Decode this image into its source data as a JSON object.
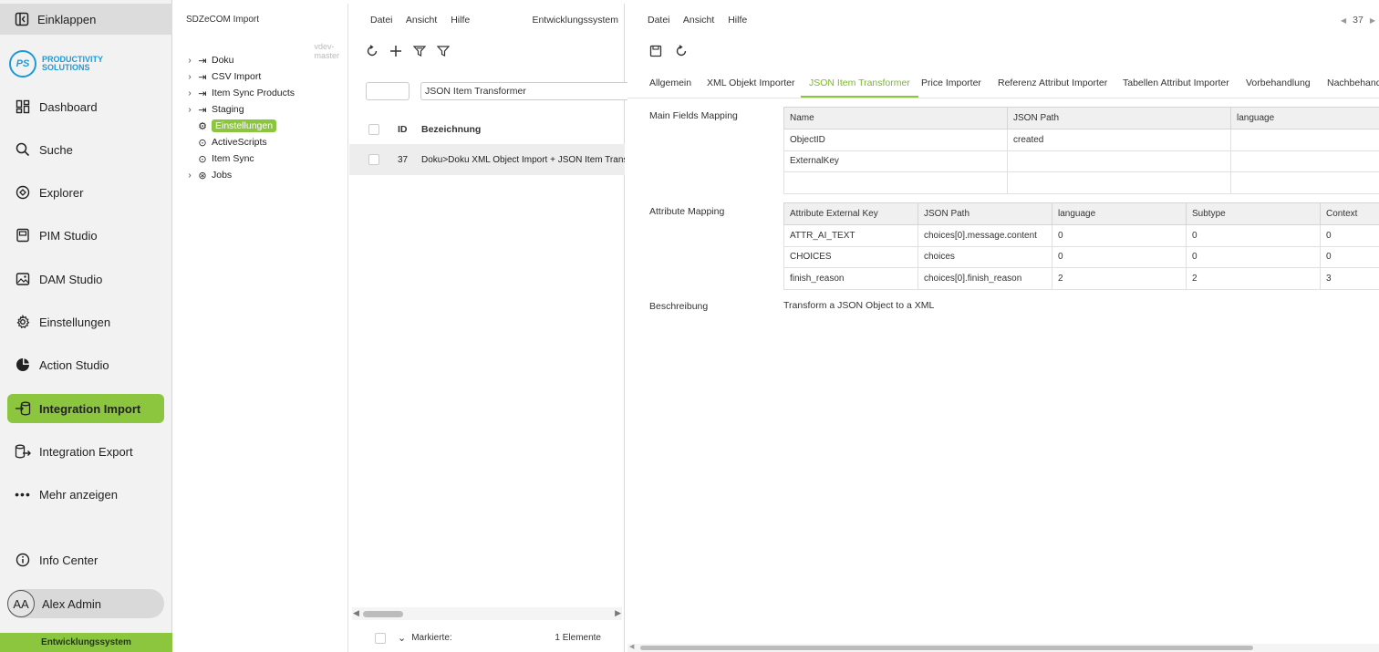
{
  "sidebar": {
    "collapse_label": "Einklappen",
    "logo_mark": "PS",
    "logo_line1": "PRODUCTIVITY",
    "logo_line2": "SOLUTIONS",
    "items": [
      {
        "label": "Dashboard",
        "icon": "dashboard-icon"
      },
      {
        "label": "Suche",
        "icon": "search-icon"
      },
      {
        "label": "Explorer",
        "icon": "explorer-icon"
      },
      {
        "label": "PIM Studio",
        "icon": "pim-icon"
      },
      {
        "label": "DAM Studio",
        "icon": "image-icon"
      },
      {
        "label": "Einstellungen",
        "icon": "gear-icon"
      },
      {
        "label": "Action Studio",
        "icon": "action-icon"
      },
      {
        "label": "Integration Import",
        "icon": "import-icon"
      },
      {
        "label": "Integration Export",
        "icon": "export-icon"
      },
      {
        "label": "Mehr anzeigen",
        "icon": "more-icon"
      }
    ],
    "info_center": "Info Center",
    "user_initials": "AA",
    "user_name": "Alex Admin",
    "footer": "Entwicklungssystem",
    "accent": "#8cc63f"
  },
  "tree": {
    "title": "SDZeCOM Import",
    "branch": "vdev-master",
    "nodes": [
      {
        "label": "Doku"
      },
      {
        "label": "CSV Import"
      },
      {
        "label": "Item Sync Products"
      },
      {
        "label": "Staging"
      },
      {
        "label": "Einstellungen"
      },
      {
        "label": "ActiveScripts"
      },
      {
        "label": "Item Sync"
      },
      {
        "label": "Jobs"
      }
    ]
  },
  "list": {
    "menu": [
      "Datei",
      "Ansicht",
      "Hilfe"
    ],
    "system": "Entwicklungssystem",
    "filter_id": "",
    "filter_name": "JSON Item Transformer",
    "col_id": "ID",
    "col_name": "Bezeichnung",
    "rows": [
      {
        "id": "37",
        "name": "Doku>Doku XML Object Import + JSON Item Transformer"
      }
    ],
    "footer_marked": "Markierte:",
    "footer_count": "1 Elemente"
  },
  "detail": {
    "menu": [
      "Datei",
      "Ansicht",
      "Hilfe"
    ],
    "record_nav": "37",
    "tabs": [
      "Allgemein",
      "XML Objekt Importer",
      "JSON Item Transformer",
      "Price Importer",
      "Referenz Attribut Importer",
      "Tabellen Attribut Importer",
      "Vorbehandlung",
      "Nachbehandlung"
    ],
    "active_tab": "JSON Item Transformer",
    "main_fields_label": "Main Fields Mapping",
    "main_fields_headers": [
      "Name",
      "JSON Path",
      "language"
    ],
    "main_fields_rows": [
      [
        "ObjectID",
        "created",
        ""
      ],
      [
        "ExternalKey",
        "",
        ""
      ],
      [
        "",
        "",
        ""
      ]
    ],
    "attr_label": "Attribute Mapping",
    "attr_headers": [
      "Attribute External Key",
      "JSON Path",
      "language",
      "Subtype",
      "Context"
    ],
    "attr_rows": [
      [
        "ATTR_AI_TEXT",
        "choices[0].message.content",
        "0",
        "0",
        "0"
      ],
      [
        "CHOICES",
        "choices",
        "0",
        "0",
        "0"
      ],
      [
        "finish_reason",
        "choices[0].finish_reason",
        "2",
        "2",
        "3"
      ]
    ],
    "desc_label": "Beschreibung",
    "desc_value": "Transform a JSON Object to a XML"
  }
}
